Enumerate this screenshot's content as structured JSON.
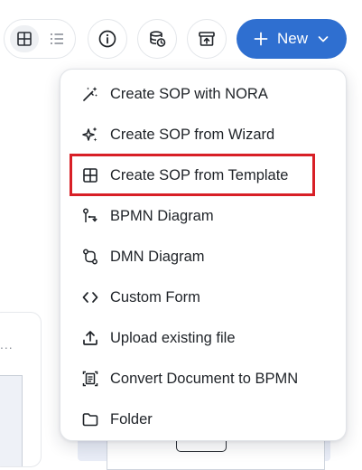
{
  "toolbar": {
    "view_toggle": {
      "grid_icon": "grid-icon",
      "list_icon": "list-icon",
      "active": "grid"
    },
    "info_icon": "info-icon",
    "history_icon": "history-icon",
    "archive_icon": "archive-icon",
    "new_button": {
      "label": "New",
      "plus_icon": "plus-icon",
      "chevron_icon": "chevron-down-icon",
      "color": "#2f6fd0"
    }
  },
  "menu": {
    "items": [
      {
        "label": "Create SOP with NORA",
        "icon": "magic-wand-icon"
      },
      {
        "label": "Create SOP from Wizard",
        "icon": "sparkles-icon"
      },
      {
        "label": "Create SOP from Template",
        "icon": "template-grid-icon",
        "highlighted": true
      },
      {
        "label": "BPMN Diagram",
        "icon": "bpmn-flow-icon"
      },
      {
        "label": "DMN Diagram",
        "icon": "dmn-flow-icon"
      },
      {
        "label": "Custom Form",
        "icon": "code-brackets-icon"
      },
      {
        "label": "Upload existing file",
        "icon": "upload-icon"
      },
      {
        "label": "Convert Document to BPMN",
        "icon": "convert-document-icon"
      },
      {
        "label": "Folder",
        "icon": "folder-icon"
      }
    ],
    "highlight_color": "#d81f26"
  },
  "background": {
    "card_menu": "..."
  }
}
